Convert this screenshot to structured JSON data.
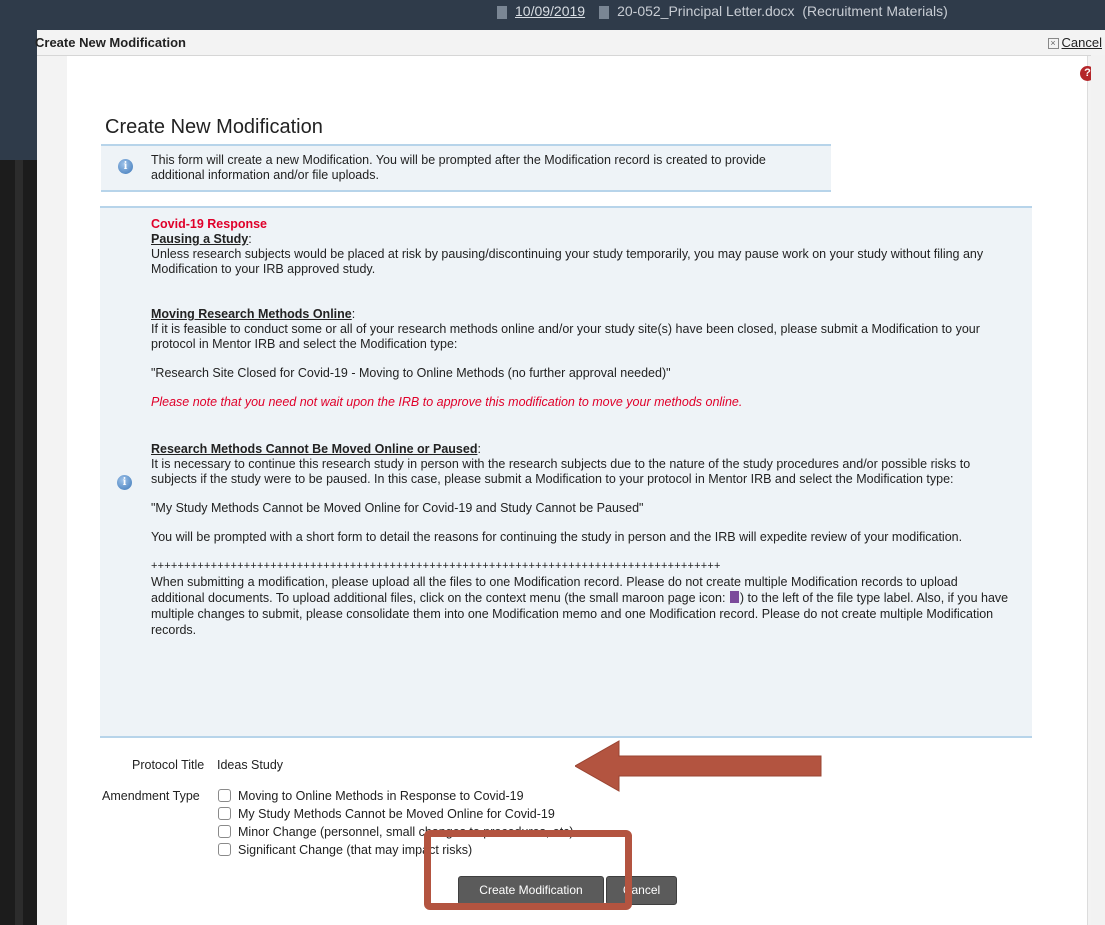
{
  "background": {
    "row1": {
      "date": "10/09/2019",
      "file": "20-052_Principal Letter.docx",
      "category": "(Recruitment Materials)"
    }
  },
  "dialog": {
    "title": "Create New Modification",
    "cancel_label": "Cancel"
  },
  "form": {
    "heading": "Create New Modification",
    "info_message": "This form will create a new Modification. You will be prompted after the Modification record is created to provide additional information and/or file uploads.",
    "covid": {
      "title": "Covid-19 Response",
      "pausing_head": "Pausing a Study",
      "pausing_text": "Unless research subjects would be placed at risk by pausing/discontinuing your study temporarily, you may pause work on your study without filing any Modification to your IRB approved study.",
      "online_head": "Moving Research Methods Online",
      "online_text": "If it is feasible to conduct some or all of your research methods online and/or your study site(s) have been closed, please submit a Modification to your protocol in Mentor IRB and select the Modification type:",
      "online_quote": "\"Research Site Closed for Covid-19 - Moving to Online Methods (no further approval needed)\"",
      "online_note": "Please note that you need not wait upon the IRB to approve this modification to move your methods online.",
      "cannot_head": "Research Methods Cannot Be Moved Online or Paused",
      "cannot_text": "It is necessary to continue this research study in person with the research subjects due to the nature of the study procedures and/or possible risks to subjects if the study were to be paused. In this case, please submit a Modification to your protocol in Mentor IRB and select the Modification type:",
      "cannot_quote": "\"My Study Methods Cannot be Moved Online for Covid-19 and Study Cannot be Paused\"",
      "cannot_note": "You will be prompted with a short form to detail the reasons for continuing the study in person and the IRB will expedite review of your modification.",
      "separator": "++++++++++++++++++++++++++++++++++++++++++++++++++++++++++++++++++++++++++++++++++++++",
      "upload_text_1": "When submitting a modification, please upload all the files to one Modification record. Please do not create multiple Modification records to upload additional documents. To upload additional files, click on the context menu (the small maroon page icon: ",
      "upload_text_2": ") to the left of the file type label. Also, if you have multiple changes to submit, please consolidate them into one Modification memo and one Modification record. Please do not create multiple Modification records."
    },
    "protocol_title_label": "Protocol Title",
    "protocol_title_value": "Ideas Study",
    "amendment_type_label": "Amendment Type",
    "amendment_options": [
      "Moving to Online Methods in Response to Covid-19",
      "My Study Methods Cannot be Moved Online for Covid-19",
      "Minor Change (personnel, small changes to procedures, etc)",
      "Significant Change (that may impact risks)"
    ],
    "create_button": "Create Modification",
    "cancel_button": "Cancel"
  },
  "annotation_color": "#b35440",
  "alert_color": "#e0002a"
}
